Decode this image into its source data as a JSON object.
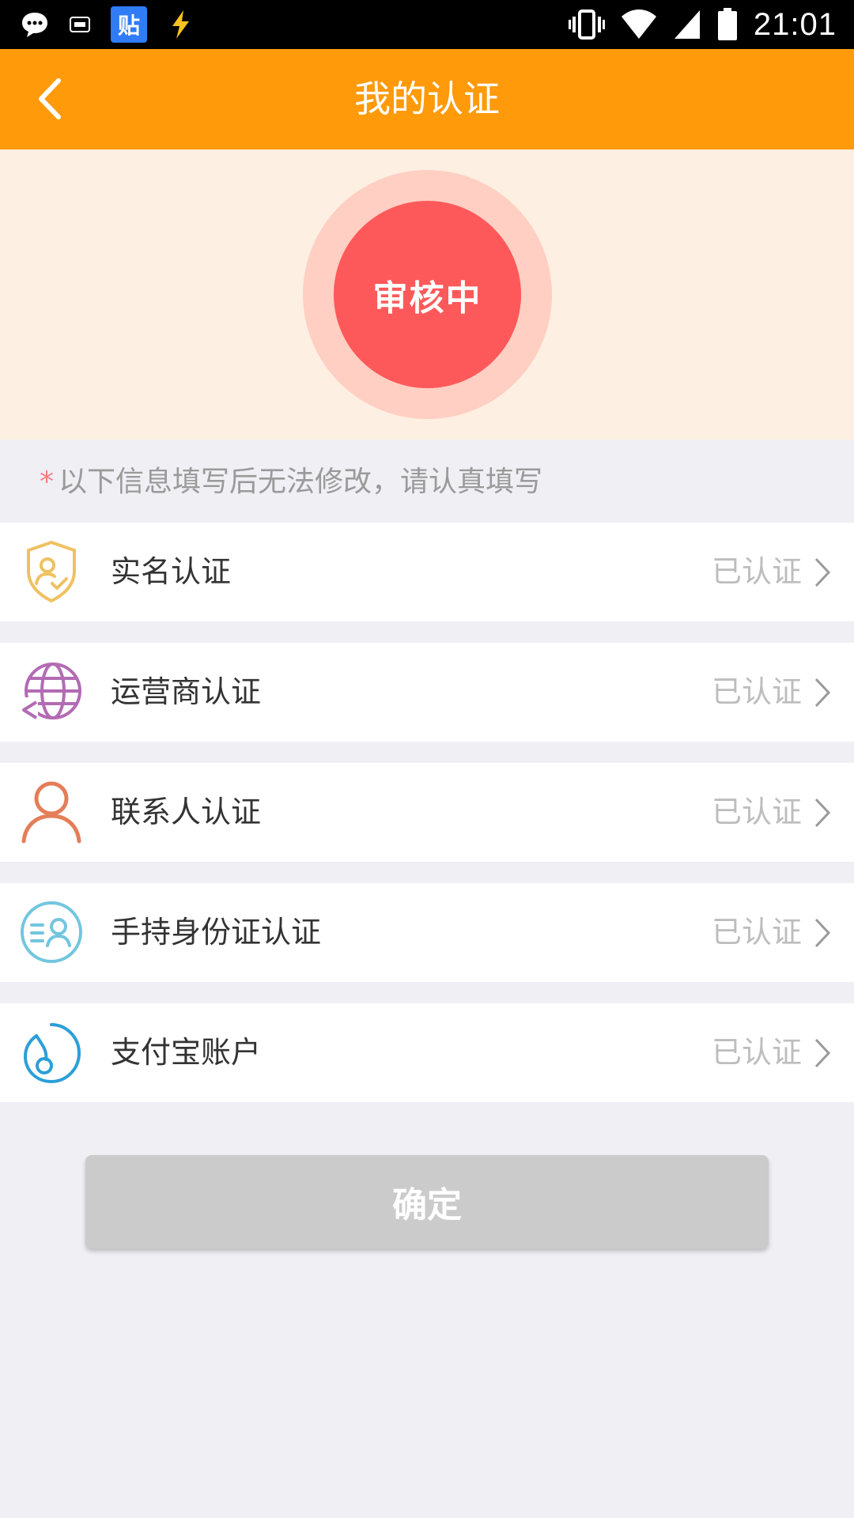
{
  "status_bar": {
    "time": "21:01",
    "tieba_badge": "贴",
    "left_icons": [
      "chat-bubble-icon",
      "iqiyi-icon",
      "tieba-icon",
      "flash-icon"
    ],
    "right_icons": [
      "vibrate-icon",
      "wifi-icon",
      "cell-signal-icon",
      "battery-icon"
    ]
  },
  "header": {
    "title": "我的认证",
    "back_icon": "chevron-left-icon",
    "background": "#ff9a0b"
  },
  "banner": {
    "status_text": "审核中",
    "circle_color": "#fe595a",
    "ring_color": "#ffcfc3"
  },
  "notice": {
    "asterisk": "*",
    "text": "以下信息填写后无法修改，请认真填写"
  },
  "items": [
    {
      "label": "实名认证",
      "status": "已认证",
      "icon": "shield-person-icon",
      "color": "#efc161"
    },
    {
      "label": "运营商认证",
      "status": "已认证",
      "icon": "globe-icon",
      "color": "#b36bb3"
    },
    {
      "label": "联系人认证",
      "status": "已认证",
      "icon": "person-icon",
      "color": "#e47e58"
    },
    {
      "label": "手持身份证认证",
      "status": "已认证",
      "icon": "id-card-icon",
      "color": "#72c6df"
    },
    {
      "label": "支付宝账户",
      "status": "已认证",
      "icon": "alipay-icon",
      "color": "#2b9fd8"
    }
  ],
  "confirm_button": {
    "label": "确定"
  }
}
